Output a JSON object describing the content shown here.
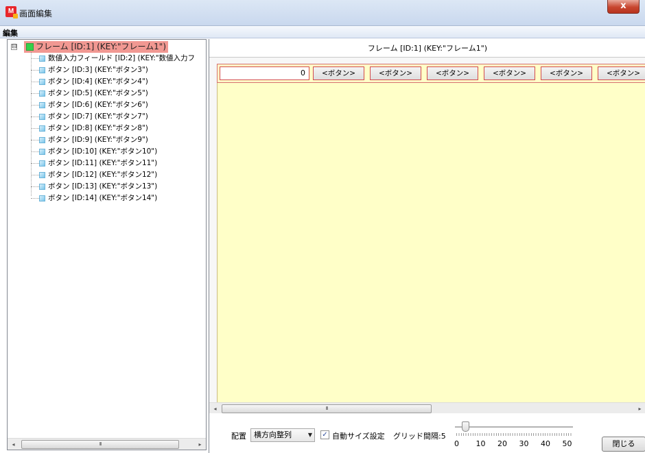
{
  "window": {
    "title": "画面編集",
    "app_icon_letter": "M",
    "close_glyph": "x"
  },
  "menu": {
    "items": [
      "編集"
    ]
  },
  "tree": {
    "expander": "⊟",
    "root": "フレーム [ID:1] (KEY:\"フレーム1\")",
    "children": [
      "数値入力フィールド [ID:2] (KEY:\"数値入力フ",
      "ボタン [ID:3] (KEY:\"ボタン3\")",
      "ボタン [ID:4] (KEY:\"ボタン4\")",
      "ボタン [ID:5] (KEY:\"ボタン5\")",
      "ボタン [ID:6] (KEY:\"ボタン6\")",
      "ボタン [ID:7] (KEY:\"ボタン7\")",
      "ボタン [ID:8] (KEY:\"ボタン8\")",
      "ボタン [ID:9] (KEY:\"ボタン9\")",
      "ボタン [ID:10] (KEY:\"ボタン10\")",
      "ボタン [ID:11] (KEY:\"ボタン11\")",
      "ボタン [ID:12] (KEY:\"ボタン12\")",
      "ボタン [ID:13] (KEY:\"ボタン13\")",
      "ボタン [ID:14] (KEY:\"ボタン14\")"
    ]
  },
  "editor": {
    "frame_title": "フレーム [ID:1] (KEY:\"フレーム1\")",
    "number_field_value": "0",
    "button_label": "<ボタン>",
    "buttons_visible": 6
  },
  "scrollbars": {
    "thumb_grip": "III",
    "left_arrow": "◂",
    "right_arrow": "▸"
  },
  "controls": {
    "layout_label": "配置",
    "layout_value": "横方向整列",
    "dropdown_arrow": "▼",
    "auto_size_label": "自動サイズ設定",
    "auto_size_checked": true,
    "check_mark": "✓",
    "grid_label": "グリッド間隔:5",
    "grid_value": 5,
    "grid_ticks": [
      "0",
      "10",
      "20",
      "30",
      "40",
      "50"
    ],
    "close_button": "閉じる"
  },
  "colors": {
    "frame_background": "#ffffc8",
    "selected_highlight": "#f19892",
    "component_border": "#d24a4a"
  }
}
